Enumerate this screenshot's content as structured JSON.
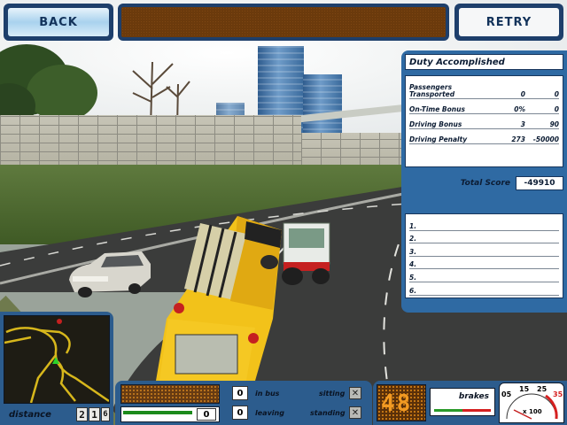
{
  "top_bar": {
    "back_label": "BACK",
    "retry_label": "RETRY"
  },
  "results": {
    "title": "Duty Accomplished",
    "stats": [
      {
        "label": "Passengers Transported",
        "value1": "0",
        "value2": "0"
      },
      {
        "label": "On-Time Bonus",
        "value1": "0%",
        "value2": "0"
      },
      {
        "label": "Driving Bonus",
        "value1": "3",
        "value2": "90"
      },
      {
        "label": "Driving Penalty",
        "value1": "273",
        "value2": "-50000"
      }
    ],
    "total_score_label": "Total Score",
    "total_score_value": "-49910",
    "leaderboard": [
      "1.",
      "2.",
      "3.",
      "4.",
      "5.",
      "6."
    ]
  },
  "hud": {
    "distance_label": "distance",
    "distance_digits": [
      "2",
      "1",
      "6"
    ],
    "passenger_bar_count": "0",
    "in_bus_count": "0",
    "in_bus_label": "in bus",
    "leaving_count": "0",
    "leaving_label": "leaving",
    "sitting_label": "sitting",
    "standing_label": "standing",
    "speed_value": "48",
    "brakes_label": "brakes",
    "gauge_ticks": [
      "05",
      "15",
      "25",
      "35"
    ],
    "gauge_multiplier": "x 100"
  },
  "colors": {
    "panel_blue": "#2c5c8d",
    "led_amber": "#e28a18",
    "bus_yellow": "#f2c21a",
    "penalty_red": "#d52020"
  }
}
